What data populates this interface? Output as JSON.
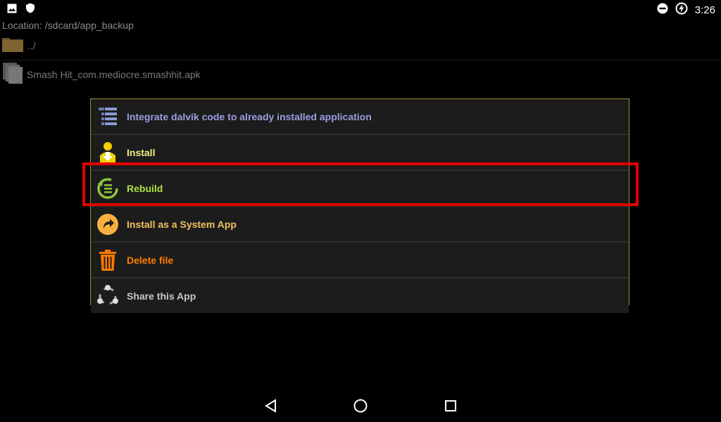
{
  "status": {
    "time": "3:26",
    "left_icons": [
      "image-icon",
      "shield-icon"
    ],
    "right_icons": [
      "do-not-disturb-icon",
      "battery-charging-icon"
    ]
  },
  "location": "Location: /sdcard/app_backup",
  "files": [
    {
      "label": "../",
      "icon": "folder-icon"
    },
    {
      "label": "Smash Hit_com.mediocre.smashhit.apk",
      "icon": "file-icon"
    }
  ],
  "menu": {
    "items": [
      {
        "label": "Integrate dalvik code to already installed application",
        "color": "#9c9ce0",
        "icon": "stack-icon"
      },
      {
        "label": "Install",
        "color": "#f0f080",
        "icon": "install-icon"
      },
      {
        "label": "Rebuild",
        "color": "#b0e040",
        "icon": "rebuild-icon"
      },
      {
        "label": "Install as a System App",
        "color": "#f0c060",
        "icon": "system-app-icon"
      },
      {
        "label": "Delete file",
        "color": "#ff8000",
        "icon": "trash-icon"
      },
      {
        "label": "Share this App",
        "color": "#c8c8c8",
        "icon": "share-icon"
      }
    ]
  },
  "highlight_color": "#e00000",
  "nav": [
    "back-icon",
    "home-icon",
    "recents-icon"
  ]
}
